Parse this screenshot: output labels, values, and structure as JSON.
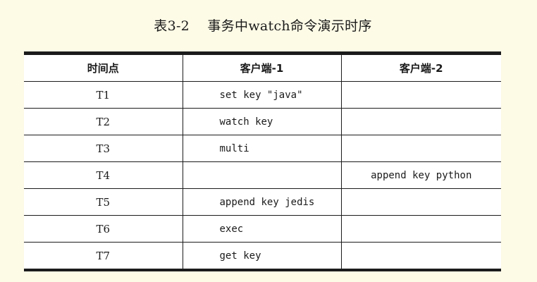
{
  "caption": {
    "number": "表3-2",
    "title": "事务中watch命令演示时序"
  },
  "table": {
    "headers": [
      "时间点",
      "客户端-1",
      "客户端-2"
    ],
    "rows": [
      {
        "time": "T1",
        "client1": "set key \"java\"",
        "client2": ""
      },
      {
        "time": "T2",
        "client1": "watch key",
        "client2": ""
      },
      {
        "time": "T3",
        "client1": "multi",
        "client2": ""
      },
      {
        "time": "T4",
        "client1": "",
        "client2": "append key python"
      },
      {
        "time": "T5",
        "client1": "append key jedis",
        "client2": ""
      },
      {
        "time": "T6",
        "client1": "exec",
        "client2": ""
      },
      {
        "time": "T7",
        "client1": "get key",
        "client2": ""
      }
    ]
  }
}
